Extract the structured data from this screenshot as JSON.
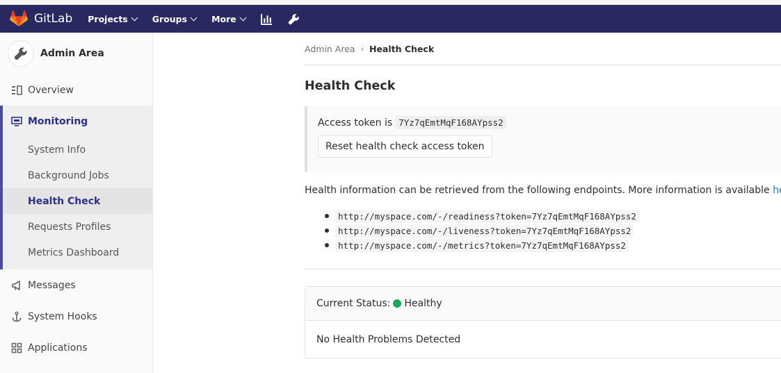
{
  "topbar": {
    "brand": "GitLab",
    "nav": [
      {
        "label": "Projects"
      },
      {
        "label": "Groups"
      },
      {
        "label": "More"
      }
    ],
    "icons": [
      "chart-bar-icon",
      "wrench-icon"
    ],
    "colors": {
      "background": "#292961",
      "logo_orange": "#fc6d26"
    }
  },
  "sidebar": {
    "title": "Admin Area",
    "items": [
      {
        "label": "Overview",
        "icon": "overview-icon"
      },
      {
        "label": "Monitoring",
        "icon": "monitor-icon"
      },
      {
        "label": "Messages",
        "icon": "megaphone-icon"
      },
      {
        "label": "System Hooks",
        "icon": "anchor-icon"
      },
      {
        "label": "Applications",
        "icon": "grid-icon"
      }
    ],
    "monitoring_sub": [
      {
        "label": "System Info"
      },
      {
        "label": "Background Jobs"
      },
      {
        "label": "Health Check"
      },
      {
        "label": "Requests Profiles"
      },
      {
        "label": "Metrics Dashboard"
      }
    ],
    "active_color": "#2f2f87"
  },
  "breadcrumb": {
    "parent": "Admin Area",
    "current": "Health Check"
  },
  "page": {
    "title": "Health Check",
    "token_label": "Access token is",
    "token": "7Yz7qEmtMqF168AYpss2",
    "reset_button": "Reset health check access token",
    "info_text": "Health information can be retrieved from the following endpoints. More information is available",
    "info_link": "here",
    "endpoints": [
      "http://myspace.com/-/readiness?token=7Yz7qEmtMqF168AYpss2",
      "http://myspace.com/-/liveness?token=7Yz7qEmtMqF168AYpss2",
      "http://myspace.com/-/metrics?token=7Yz7qEmtMqF168AYpss2"
    ],
    "status_label": "Current Status:",
    "status_value": "Healthy",
    "status_color": "#1aaa55",
    "status_body": "No Health Problems Detected"
  }
}
